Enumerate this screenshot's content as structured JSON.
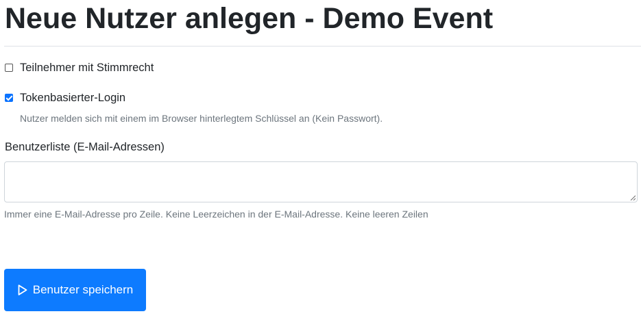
{
  "page": {
    "title": "Neue Nutzer anlegen - Demo Event"
  },
  "options": {
    "voting": {
      "label": "Teilnehmer mit Stimmrecht",
      "checked": false
    },
    "token_login": {
      "label": "Tokenbasierter-Login",
      "checked": true,
      "help": "Nutzer melden sich mit einem im Browser hinterlegtem Schlüssel an (Kein Passwort)."
    }
  },
  "user_list": {
    "label": "Benutzerliste (E-Mail-Adressen)",
    "value": "",
    "help": "Immer eine E-Mail-Adresse pro Zeile. Keine Leerzeichen in der E-Mail-Adresse. Keine leeren Zeilen"
  },
  "actions": {
    "save_label": "Benutzer speichern",
    "save_icon": "play-icon"
  },
  "colors": {
    "primary": "#0d7bff",
    "text": "#212529",
    "muted": "#6c757d",
    "border": "#ced4da"
  }
}
